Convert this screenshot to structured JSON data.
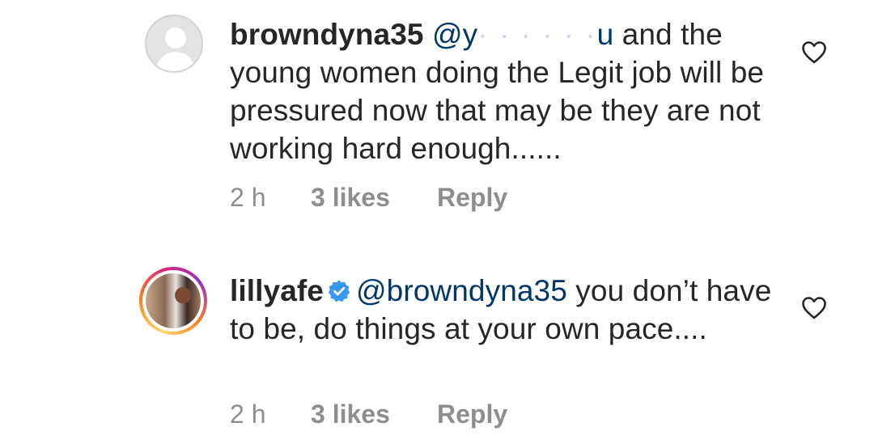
{
  "comments": [
    {
      "username": "browndyna35",
      "mention": "@y",
      "mention_obscured": "· · · · · ·",
      "mention_tail": "u",
      "text": " and the young women doing the Legit job will be pressured now that may be they are not working hard enough......",
      "time": "2 h",
      "likes": "3 likes",
      "reply": "Reply",
      "verified": false
    },
    {
      "username": "lillyafe",
      "mention": "@browndyna35",
      "text": " you don’t have to be, do things at your own pace....",
      "time": "2 h",
      "likes": "3 likes",
      "reply": "Reply",
      "verified": true
    }
  ],
  "colors": {
    "text": "#262626",
    "mention": "#00376b",
    "meta": "#8e8e8e",
    "verified_badge": "#3897f0"
  }
}
